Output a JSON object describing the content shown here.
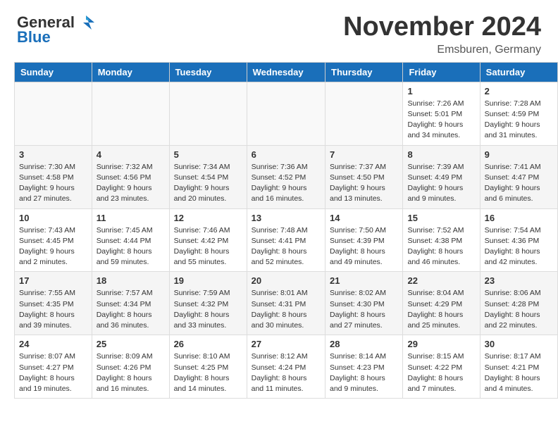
{
  "header": {
    "logo_general": "General",
    "logo_blue": "Blue",
    "month_title": "November 2024",
    "location": "Emsburen, Germany"
  },
  "days_of_week": [
    "Sunday",
    "Monday",
    "Tuesday",
    "Wednesday",
    "Thursday",
    "Friday",
    "Saturday"
  ],
  "weeks": [
    [
      {
        "day": "",
        "info": ""
      },
      {
        "day": "",
        "info": ""
      },
      {
        "day": "",
        "info": ""
      },
      {
        "day": "",
        "info": ""
      },
      {
        "day": "",
        "info": ""
      },
      {
        "day": "1",
        "info": "Sunrise: 7:26 AM\nSunset: 5:01 PM\nDaylight: 9 hours and 34 minutes."
      },
      {
        "day": "2",
        "info": "Sunrise: 7:28 AM\nSunset: 4:59 PM\nDaylight: 9 hours and 31 minutes."
      }
    ],
    [
      {
        "day": "3",
        "info": "Sunrise: 7:30 AM\nSunset: 4:58 PM\nDaylight: 9 hours and 27 minutes."
      },
      {
        "day": "4",
        "info": "Sunrise: 7:32 AM\nSunset: 4:56 PM\nDaylight: 9 hours and 23 minutes."
      },
      {
        "day": "5",
        "info": "Sunrise: 7:34 AM\nSunset: 4:54 PM\nDaylight: 9 hours and 20 minutes."
      },
      {
        "day": "6",
        "info": "Sunrise: 7:36 AM\nSunset: 4:52 PM\nDaylight: 9 hours and 16 minutes."
      },
      {
        "day": "7",
        "info": "Sunrise: 7:37 AM\nSunset: 4:50 PM\nDaylight: 9 hours and 13 minutes."
      },
      {
        "day": "8",
        "info": "Sunrise: 7:39 AM\nSunset: 4:49 PM\nDaylight: 9 hours and 9 minutes."
      },
      {
        "day": "9",
        "info": "Sunrise: 7:41 AM\nSunset: 4:47 PM\nDaylight: 9 hours and 6 minutes."
      }
    ],
    [
      {
        "day": "10",
        "info": "Sunrise: 7:43 AM\nSunset: 4:45 PM\nDaylight: 9 hours and 2 minutes."
      },
      {
        "day": "11",
        "info": "Sunrise: 7:45 AM\nSunset: 4:44 PM\nDaylight: 8 hours and 59 minutes."
      },
      {
        "day": "12",
        "info": "Sunrise: 7:46 AM\nSunset: 4:42 PM\nDaylight: 8 hours and 55 minutes."
      },
      {
        "day": "13",
        "info": "Sunrise: 7:48 AM\nSunset: 4:41 PM\nDaylight: 8 hours and 52 minutes."
      },
      {
        "day": "14",
        "info": "Sunrise: 7:50 AM\nSunset: 4:39 PM\nDaylight: 8 hours and 49 minutes."
      },
      {
        "day": "15",
        "info": "Sunrise: 7:52 AM\nSunset: 4:38 PM\nDaylight: 8 hours and 46 minutes."
      },
      {
        "day": "16",
        "info": "Sunrise: 7:54 AM\nSunset: 4:36 PM\nDaylight: 8 hours and 42 minutes."
      }
    ],
    [
      {
        "day": "17",
        "info": "Sunrise: 7:55 AM\nSunset: 4:35 PM\nDaylight: 8 hours and 39 minutes."
      },
      {
        "day": "18",
        "info": "Sunrise: 7:57 AM\nSunset: 4:34 PM\nDaylight: 8 hours and 36 minutes."
      },
      {
        "day": "19",
        "info": "Sunrise: 7:59 AM\nSunset: 4:32 PM\nDaylight: 8 hours and 33 minutes."
      },
      {
        "day": "20",
        "info": "Sunrise: 8:01 AM\nSunset: 4:31 PM\nDaylight: 8 hours and 30 minutes."
      },
      {
        "day": "21",
        "info": "Sunrise: 8:02 AM\nSunset: 4:30 PM\nDaylight: 8 hours and 27 minutes."
      },
      {
        "day": "22",
        "info": "Sunrise: 8:04 AM\nSunset: 4:29 PM\nDaylight: 8 hours and 25 minutes."
      },
      {
        "day": "23",
        "info": "Sunrise: 8:06 AM\nSunset: 4:28 PM\nDaylight: 8 hours and 22 minutes."
      }
    ],
    [
      {
        "day": "24",
        "info": "Sunrise: 8:07 AM\nSunset: 4:27 PM\nDaylight: 8 hours and 19 minutes."
      },
      {
        "day": "25",
        "info": "Sunrise: 8:09 AM\nSunset: 4:26 PM\nDaylight: 8 hours and 16 minutes."
      },
      {
        "day": "26",
        "info": "Sunrise: 8:10 AM\nSunset: 4:25 PM\nDaylight: 8 hours and 14 minutes."
      },
      {
        "day": "27",
        "info": "Sunrise: 8:12 AM\nSunset: 4:24 PM\nDaylight: 8 hours and 11 minutes."
      },
      {
        "day": "28",
        "info": "Sunrise: 8:14 AM\nSunset: 4:23 PM\nDaylight: 8 hours and 9 minutes."
      },
      {
        "day": "29",
        "info": "Sunrise: 8:15 AM\nSunset: 4:22 PM\nDaylight: 8 hours and 7 minutes."
      },
      {
        "day": "30",
        "info": "Sunrise: 8:17 AM\nSunset: 4:21 PM\nDaylight: 8 hours and 4 minutes."
      }
    ]
  ]
}
